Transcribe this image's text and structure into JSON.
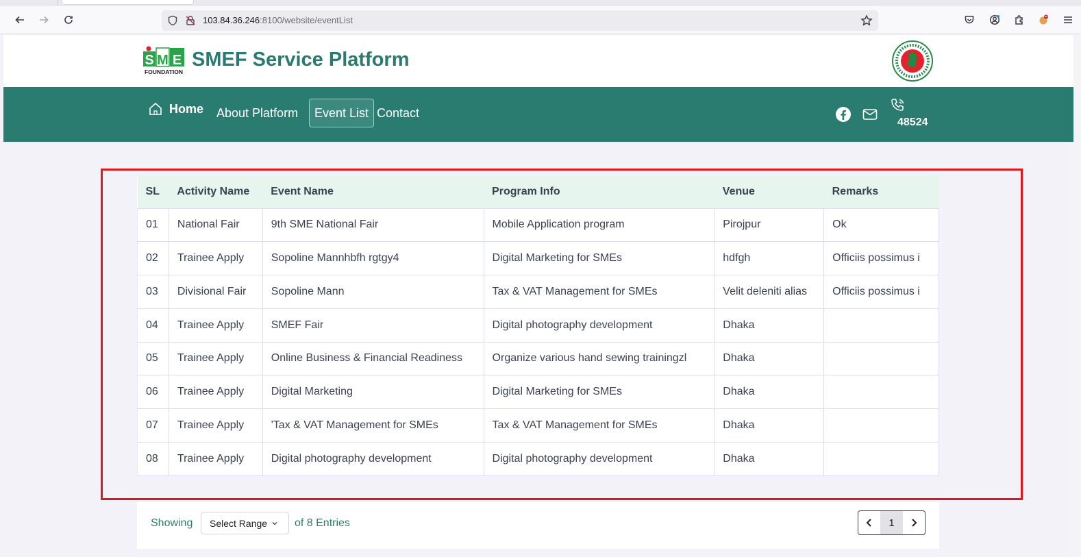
{
  "browser": {
    "url_host": "103.84.36.246",
    "url_rest": ":8100/website/eventList"
  },
  "site": {
    "logo_text": "SME",
    "logo_sub": "FOUNDATION",
    "title": "SMEF Service Platform"
  },
  "nav": {
    "home": "Home",
    "about": "About Platform",
    "events": "Event List",
    "contact": "Contact",
    "phone": "48524"
  },
  "table": {
    "headers": [
      "SL",
      "Activity Name",
      "Event Name",
      "Program Info",
      "Venue",
      "Remarks"
    ],
    "rows": [
      [
        "01",
        "National Fair",
        "9th SME National Fair",
        "Mobile Application program",
        "Pirojpur",
        "Ok"
      ],
      [
        "02",
        "Trainee Apply",
        "Sopoline Mannhbfh rgtgy4",
        "Digital Marketing for SMEs",
        "hdfgh",
        "Officiis possimus i"
      ],
      [
        "03",
        "Divisional Fair",
        "Sopoline Mann",
        "Tax & VAT Management for SMEs",
        "Velit deleniti alias",
        "Officiis possimus i"
      ],
      [
        "04",
        "Trainee Apply",
        "SMEF Fair",
        "Digital photography development",
        "Dhaka",
        ""
      ],
      [
        "05",
        "Trainee Apply",
        "Online Business & Financial Readiness",
        "Organize various hand sewing trainingzl",
        "Dhaka",
        ""
      ],
      [
        "06",
        "Trainee Apply",
        "Digital Marketing",
        "Digital Marketing for SMEs",
        "Dhaka",
        ""
      ],
      [
        "07",
        "Trainee Apply",
        "'Tax & VAT Management for SMEs",
        "Tax & VAT Management for SMEs",
        "Dhaka",
        ""
      ],
      [
        "08",
        "Trainee Apply",
        "Digital photography development",
        "Digital photography development",
        "Dhaka",
        ""
      ]
    ]
  },
  "footer": {
    "showing": "Showing",
    "range_select": "Select Range",
    "of_entries": "of 8 Entries",
    "current_page": "1"
  },
  "colors": {
    "brand": "#2b7c70",
    "header_row": "#e6f5ee",
    "highlight": "#e3151b"
  },
  "icons": [
    "back-icon",
    "forward-icon",
    "reload-icon",
    "shield-icon",
    "lock-slash-icon",
    "star-icon",
    "pocket-icon",
    "account-icon",
    "extensions-icon",
    "fox-icon",
    "menu-icon",
    "home-icon",
    "facebook-icon",
    "mail-icon",
    "phone-icon",
    "chevron-down-icon",
    "chevron-left-icon",
    "chevron-right-icon"
  ]
}
